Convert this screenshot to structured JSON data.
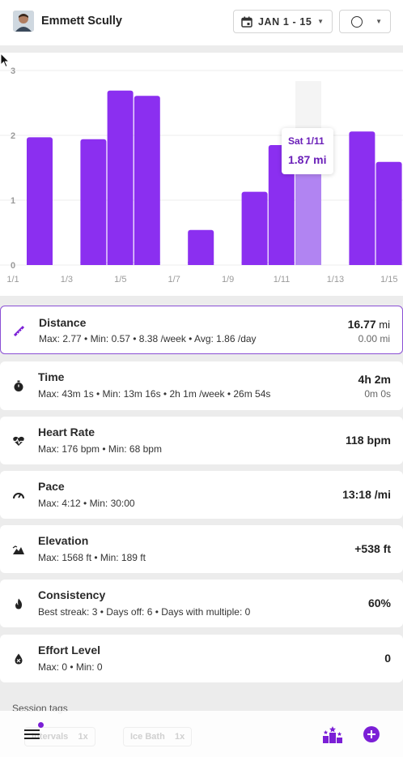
{
  "header": {
    "user_name": "Emmett Scully",
    "date_range": "JAN 1 - 15"
  },
  "chart_data": {
    "type": "bar",
    "x": [
      "1/1",
      "1/2",
      "1/3",
      "1/4",
      "1/5",
      "1/6",
      "1/7",
      "1/8",
      "1/9",
      "1/10",
      "1/11",
      "1/12",
      "1/13",
      "1/14",
      "1/15"
    ],
    "values": [
      1.97,
      0,
      1.94,
      2.69,
      2.61,
      0,
      0.54,
      0,
      1.13,
      1.85,
      1.87,
      0,
      2.06,
      1.59,
      0
    ],
    "y_ticks": [
      "0",
      "1",
      "2",
      "3"
    ],
    "x_tick_labels": [
      "1/1",
      "1/3",
      "1/5",
      "1/7",
      "1/9",
      "1/11",
      "1/13",
      "1/15"
    ],
    "ylim": [
      0,
      3
    ],
    "highlighted_index": 10,
    "bar_color": "#8b2ff0",
    "highlight_color": "#b184f2",
    "grid": true
  },
  "tooltip": {
    "day": "Sat 1/11",
    "value": "1.87 mi"
  },
  "stats": [
    {
      "title": "Distance",
      "icon": "ruler-icon",
      "sub": "Max: 2.77 • Min: 0.57 • 8.38 /week • Avg: 1.86 /day",
      "value": "16.77",
      "unit": " mi",
      "secondary": "0.00 mi"
    },
    {
      "title": "Time",
      "icon": "stopwatch-icon",
      "sub": "Max: 43m 1s • Min: 13m 16s • 2h 1m /week • 26m 54s",
      "value": "4h 2m",
      "unit": "",
      "secondary": "0m 0s"
    },
    {
      "title": "Heart Rate",
      "icon": "heartbeat-icon",
      "sub": "Max: 176 bpm • Min: 68 bpm",
      "value": "118 bpm",
      "unit": "",
      "secondary": ""
    },
    {
      "title": "Pace",
      "icon": "speedometer-icon",
      "sub": "Max: 4:12 • Min: 30:00",
      "value": "13:18 /mi",
      "unit": "",
      "secondary": ""
    },
    {
      "title": "Elevation",
      "icon": "mountain-icon",
      "sub": "Max: 1568 ft • Min: 189 ft",
      "value": "+538 ft",
      "unit": "",
      "secondary": ""
    },
    {
      "title": "Consistency",
      "icon": "flame-icon",
      "sub": "Best streak: 3 • Days off: 6 • Days with multiple: 0",
      "value": "60%",
      "unit": "",
      "secondary": ""
    },
    {
      "title": "Effort Level",
      "icon": "effort-drop-icon",
      "sub": "Max: 0 • Min: 0",
      "value": "0",
      "unit": "",
      "secondary": ""
    }
  ],
  "session_tags": {
    "label": "Session tags",
    "tags": [
      {
        "name": "Intervals",
        "count": "1x"
      },
      {
        "name": "Ice Bath",
        "count": "1x"
      }
    ]
  },
  "colors": {
    "accent": "#7b1fd6",
    "selected_border": "#8a4fd4"
  }
}
